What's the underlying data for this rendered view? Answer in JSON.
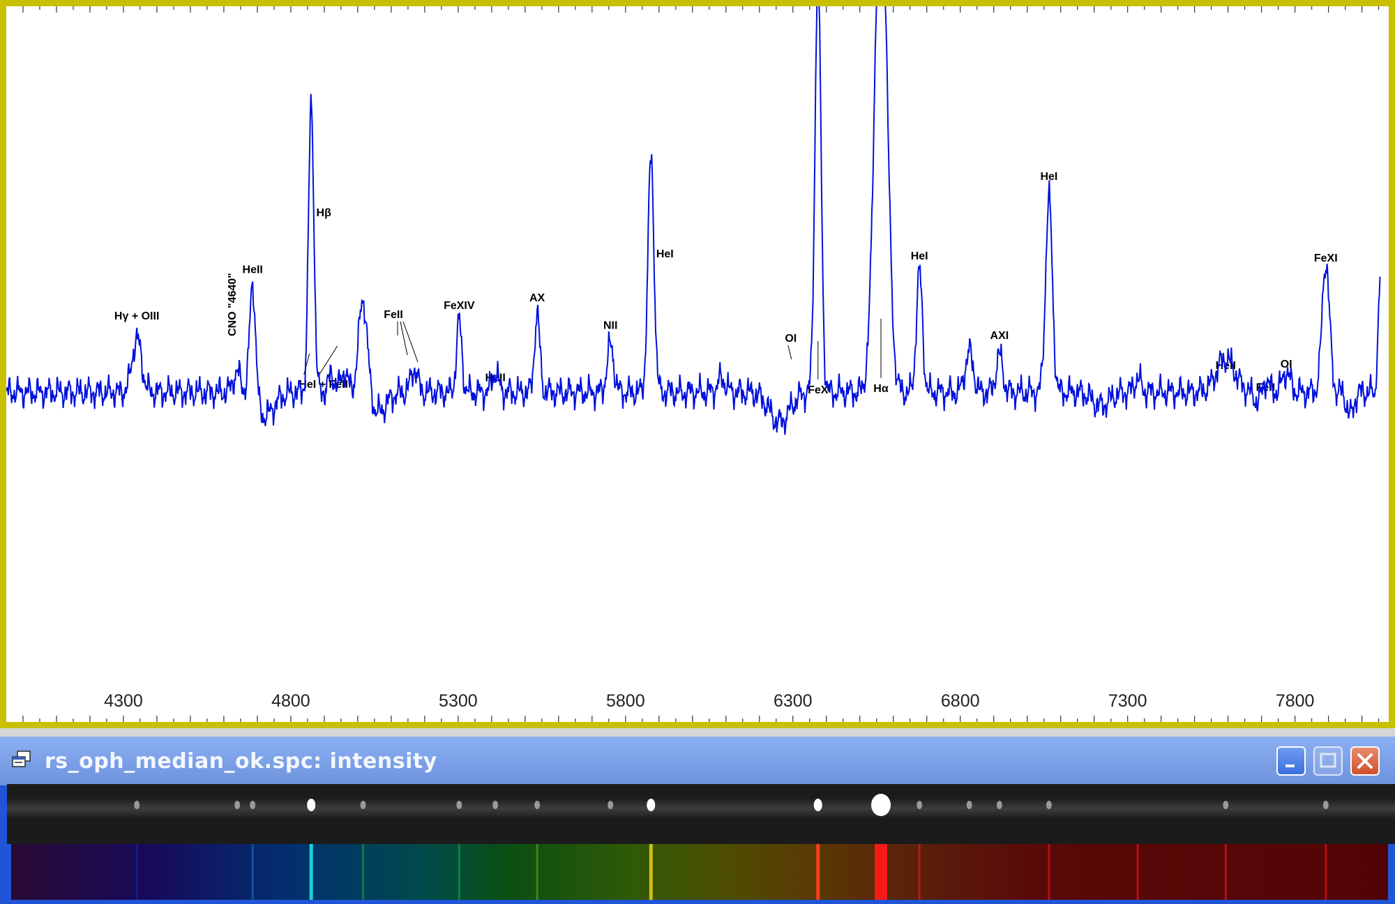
{
  "window": {
    "title": "rs_oph_median_ok.spc: intensity",
    "buttons": {
      "minimize": "minimize",
      "maximize": "maximize",
      "close": "close"
    }
  },
  "colors": {
    "frame": "#c8c000",
    "line": "#0010dd",
    "titlebar": "#7a9fe6",
    "window_border": "#1f55d6"
  },
  "chart_data": {
    "type": "line",
    "title": "",
    "xlabel": "",
    "ylabel": "",
    "xlim": [
      3950,
      8080
    ],
    "ylim": [
      -4.3,
      11.3
    ],
    "x_ticks": [
      4300,
      4800,
      5300,
      5800,
      6300,
      6800,
      7300,
      7800
    ],
    "grid": false,
    "annotations": [
      {
        "text": "Hγ + OIII",
        "x": 4340
      },
      {
        "text": "CNO \"4640\"",
        "x": 4640
      },
      {
        "text": "HeII",
        "x": 4686
      },
      {
        "text": "Hβ",
        "x": 4861
      },
      {
        "text": "HeI + FeII",
        "x": 4960
      },
      {
        "text": "FeII",
        "x": 5169
      },
      {
        "text": "FeXIV",
        "x": 5303
      },
      {
        "text": "HeII",
        "x": 5411
      },
      {
        "text": "AX",
        "x": 5536
      },
      {
        "text": "NII",
        "x": 5755
      },
      {
        "text": "HeI",
        "x": 5876
      },
      {
        "text": "OI",
        "x": 6300
      },
      {
        "text": "FeX",
        "x": 6375
      },
      {
        "text": "Hα",
        "x": 6563
      },
      {
        "text": "HeI",
        "x": 6678
      },
      {
        "text": "AXI",
        "x": 6917
      },
      {
        "text": "HeI",
        "x": 7065
      },
      {
        "text": "HeII",
        "x": 7593
      },
      {
        "text": "FeII",
        "x": 7712
      },
      {
        "text": "OI",
        "x": 7774
      },
      {
        "text": "FeXI",
        "x": 7892
      }
    ],
    "baseline": 0,
    "peaks": [
      {
        "x": 4340,
        "y": 1.6,
        "w": 14
      },
      {
        "x": 4640,
        "y": 0.6,
        "w": 12
      },
      {
        "x": 4686,
        "y": 3.6,
        "w": 9
      },
      {
        "x": 4861,
        "y": 8.6,
        "w": 8
      },
      {
        "x": 4922,
        "y": 0.5,
        "w": 10
      },
      {
        "x": 4960,
        "y": 0.6,
        "w": 10
      },
      {
        "x": 5016,
        "y": 2.9,
        "w": 13
      },
      {
        "x": 5169,
        "y": 0.7,
        "w": 10
      },
      {
        "x": 5303,
        "y": 2.1,
        "w": 8
      },
      {
        "x": 5411,
        "y": 0.6,
        "w": 9
      },
      {
        "x": 5536,
        "y": 2.3,
        "w": 8
      },
      {
        "x": 5755,
        "y": 1.4,
        "w": 10
      },
      {
        "x": 5876,
        "y": 7.0,
        "w": 9
      },
      {
        "x": 6087,
        "y": 0.4,
        "w": 12
      },
      {
        "x": 6375,
        "y": 12.5,
        "w": 9
      },
      {
        "x": 6563,
        "y": 16.0,
        "w": 18
      },
      {
        "x": 6678,
        "y": 3.6,
        "w": 9
      },
      {
        "x": 6827,
        "y": 1.2,
        "w": 12
      },
      {
        "x": 6917,
        "y": 1.1,
        "w": 10
      },
      {
        "x": 7065,
        "y": 5.8,
        "w": 10
      },
      {
        "x": 7330,
        "y": 0.4,
        "w": 10
      },
      {
        "x": 7593,
        "y": 1.0,
        "w": 28
      },
      {
        "x": 7712,
        "y": 0.4,
        "w": 10
      },
      {
        "x": 7774,
        "y": 0.6,
        "w": 12
      },
      {
        "x": 7892,
        "y": 3.9,
        "w": 11
      }
    ],
    "dips": [
      {
        "x": 4720,
        "y": -0.7,
        "w": 30
      },
      {
        "x": 5060,
        "y": -0.6,
        "w": 25
      },
      {
        "x": 6260,
        "y": -0.9,
        "w": 30
      },
      {
        "x": 7220,
        "y": -0.4,
        "w": 25
      },
      {
        "x": 7965,
        "y": -0.7,
        "w": 10
      },
      {
        "x": 7690,
        "y": -0.3,
        "w": 12
      }
    ],
    "end_value": 3.5,
    "raw_spectrum_lines": [
      4340,
      4640,
      4686,
      4861,
      5016,
      5303,
      5411,
      5536,
      5755,
      5876,
      6375,
      6563,
      6678,
      6827,
      6917,
      7065,
      7593,
      7892
    ],
    "synthetic_spectrum_lines": [
      4340,
      4686,
      4861,
      5016,
      5303,
      5536,
      5876,
      6375,
      6563,
      6678,
      7065,
      7330,
      7593,
      7892
    ]
  }
}
